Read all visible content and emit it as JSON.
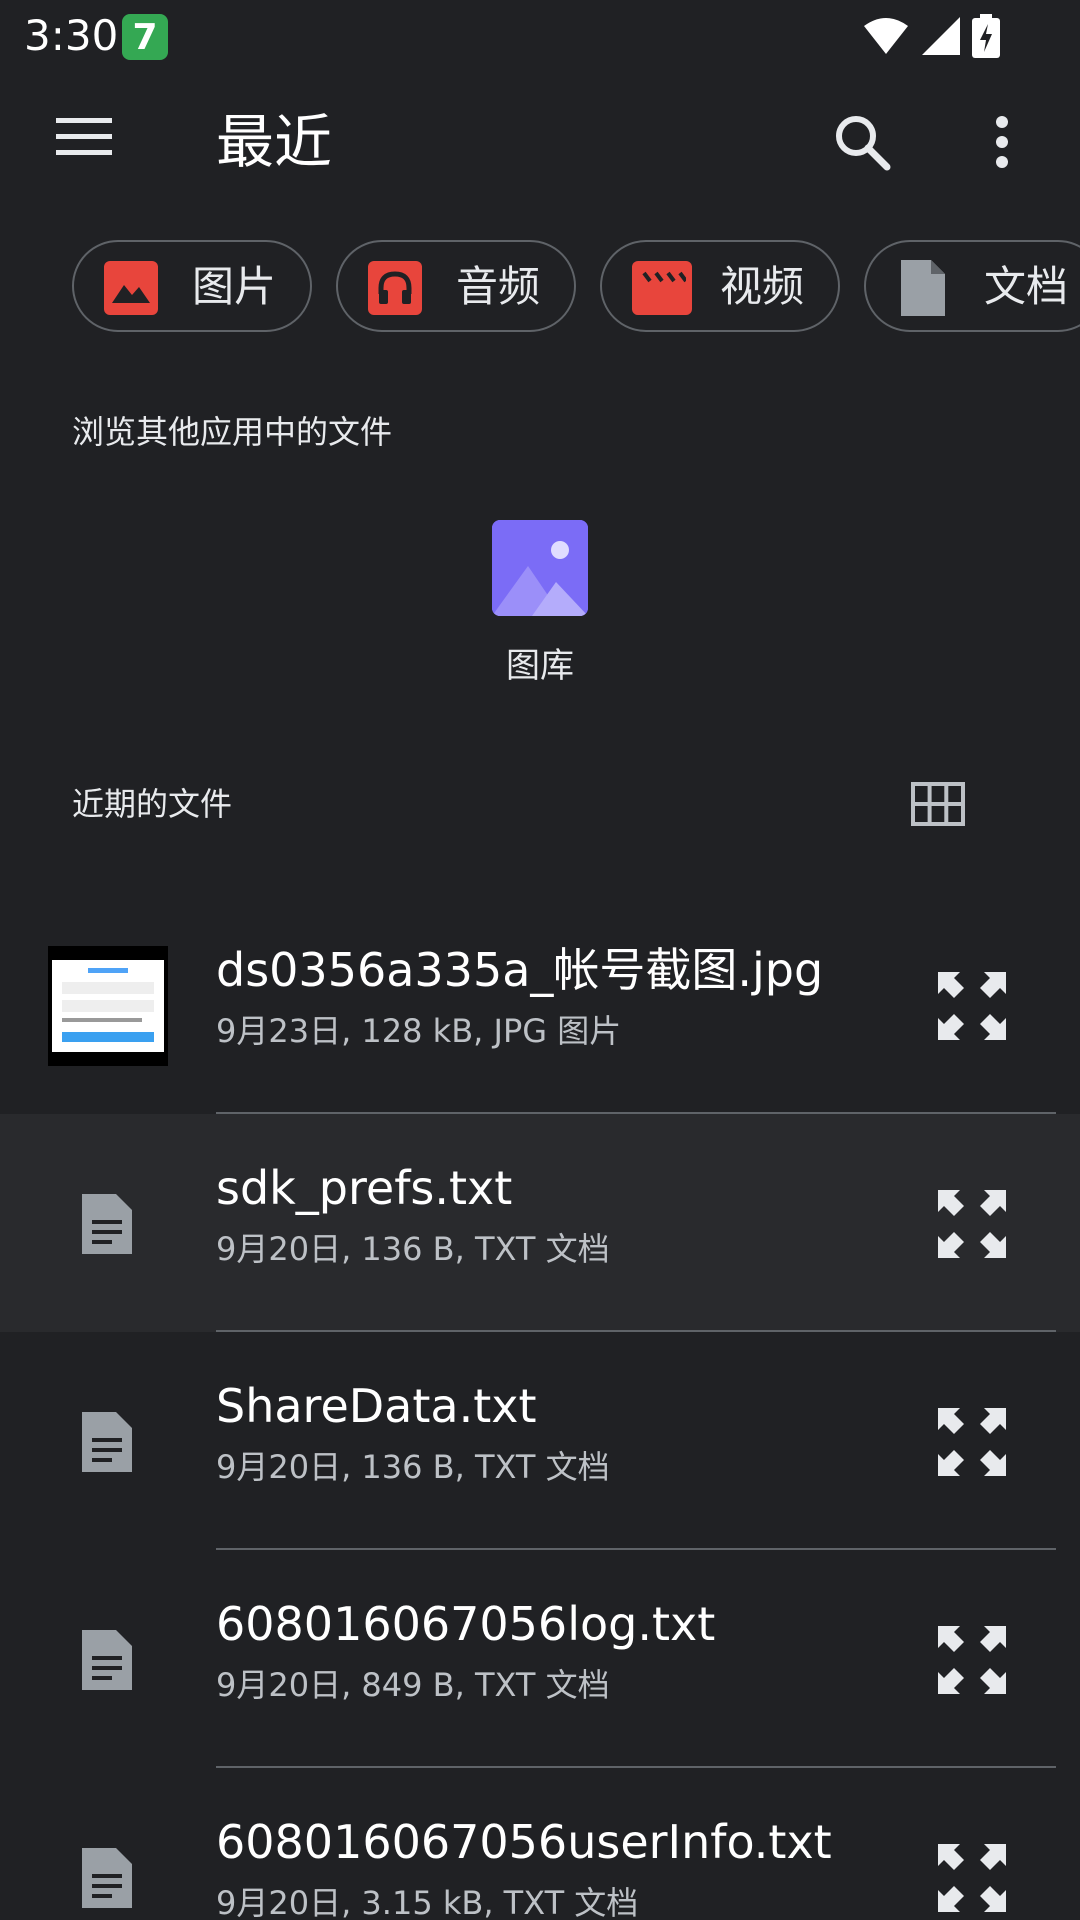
{
  "status_bar": {
    "time": "3:30",
    "app_badge": "7"
  },
  "app_bar": {
    "title": "最近"
  },
  "chips": [
    {
      "label": "图片",
      "icon": "image-icon",
      "color": "#e8453c"
    },
    {
      "label": "音频",
      "icon": "headphones-icon",
      "color": "#e8453c"
    },
    {
      "label": "视频",
      "icon": "clapperboard-icon",
      "color": "#e8453c"
    },
    {
      "label": "文档",
      "icon": "document-icon",
      "color": "#9aa0a6"
    }
  ],
  "browse_section": {
    "label": "浏览其他应用中的文件",
    "apps": [
      {
        "label": "图库",
        "icon": "gallery-icon",
        "color": "#7b6cf6"
      }
    ]
  },
  "recent_section": {
    "label": "近期的文件"
  },
  "files": [
    {
      "name": "ds0356a335a_帐号截图.jpg",
      "meta": "9月23日, 128 kB, JPG 图片",
      "type": "image"
    },
    {
      "name": "sdk_prefs.txt",
      "meta": "9月20日, 136 B, TXT 文档",
      "type": "text"
    },
    {
      "name": "ShareData.txt",
      "meta": "9月20日, 136 B, TXT 文档",
      "type": "text"
    },
    {
      "name": "608016067056log.txt",
      "meta": "9月20日, 849 B, TXT 文档",
      "type": "text"
    },
    {
      "name": "608016067056userInfo.txt",
      "meta": "9月20日, 3.15 kB, TXT 文档",
      "type": "text"
    }
  ]
}
